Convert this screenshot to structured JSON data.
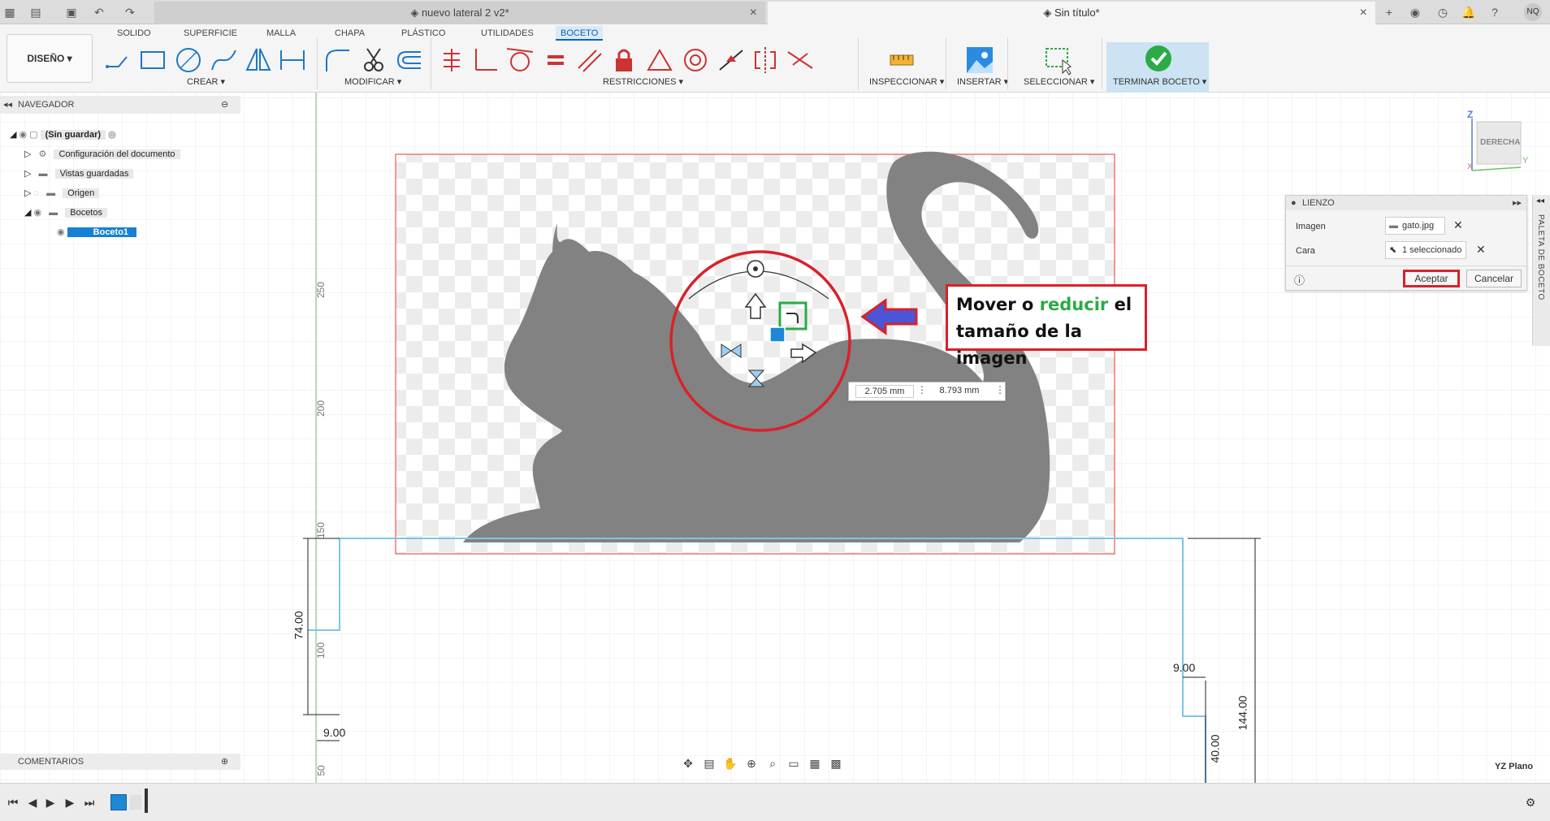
{
  "titlebar": {
    "tabs": [
      {
        "label": "nuevo lateral 2 v2*"
      },
      {
        "label": "Sin título*"
      }
    ],
    "close_glyph": "×",
    "avatar_initials": "NQ"
  },
  "toolbar": {
    "mode_label": "DISEÑO ▾",
    "workspace_tabs": [
      "SOLIDO",
      "SUPERFICIE",
      "MALLA",
      "CHAPA",
      "PLÁSTICO",
      "UTILIDADES",
      "BOCETO"
    ],
    "active_workspace": "BOCETO",
    "groups": {
      "crear": "CREAR ▾",
      "modificar": "MODIFICAR ▾",
      "restricciones": "RESTRICCIONES ▾",
      "inspeccionar": "INSPECCIONAR ▾",
      "insertar": "INSERTAR ▾",
      "seleccionar": "SELECCIONAR ▾",
      "terminar": "TERMINAR BOCETO ▾"
    },
    "accent_color": "#0a63b0",
    "finish_color": "#2bab46"
  },
  "navigator": {
    "title": "NAVEGADOR",
    "root": "(Sin guardar)",
    "items": [
      {
        "label": "Configuración del documento"
      },
      {
        "label": "Vistas guardadas"
      },
      {
        "label": "Origen"
      },
      {
        "label": "Bocetos"
      },
      {
        "label": "Boceto1"
      }
    ]
  },
  "canvas": {
    "view_cube": {
      "label": "DERECHA",
      "axis_z": "Z",
      "axis_y": "Y",
      "axis_x": "X"
    },
    "axis_ticks": [
      "250",
      "200",
      "150",
      "100",
      "50"
    ],
    "dimensions": {
      "left_height": "74.00",
      "left_width": "9.00",
      "right_width": "9.00",
      "right_height_a": "144.00",
      "right_height_b": "40.00"
    },
    "move_inputs": {
      "x": "2.705 mm",
      "y": "8.793 mm"
    },
    "plane_label": "YZ Plano"
  },
  "dialog": {
    "title": "LIENZO",
    "image_label": "Imagen",
    "image_value": "gato.jpg",
    "face_label": "Cara",
    "face_value": "1 seleccionado",
    "accept": "Aceptar",
    "cancel": "Cancelar"
  },
  "palette": {
    "label": "PALETA DE BOCETO"
  },
  "annotation": {
    "part1": "Mover o ",
    "part2": "reducir",
    "part3": " el tamaño de la imagen",
    "highlight_color": "#2bab46",
    "border_color": "#d8212a"
  },
  "comments": {
    "title": "COMENTARIOS"
  }
}
